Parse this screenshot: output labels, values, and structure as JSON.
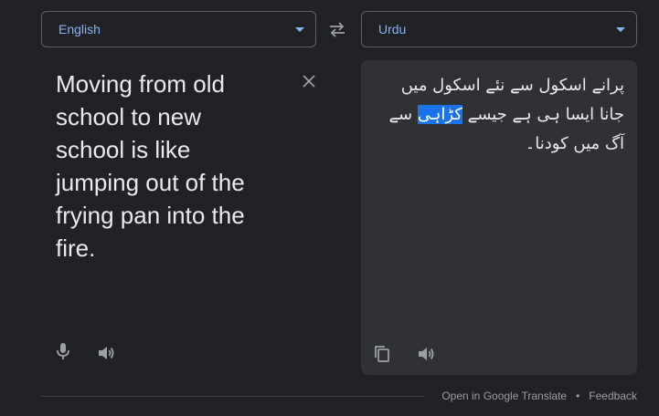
{
  "source_language": {
    "label": "English"
  },
  "target_language": {
    "label": "Urdu"
  },
  "source": {
    "text": "Moving from old school to new school is like jumping out of the frying pan into the fire."
  },
  "translation": {
    "text_before": "پرانے اسکول سے نئے اسکول میں جانا ایسا ہی ہے جیسے ",
    "text_highlight": "کڑاہی",
    "text_after": " سے آگ میں کودنا۔"
  },
  "footer": {
    "open_link": "Open in Google Translate",
    "separator": "•",
    "feedback": "Feedback"
  },
  "colors": {
    "background": "#202124",
    "panel": "#303134",
    "accent": "#8ab4f8",
    "highlight": "#1a73e8",
    "icon": "#9aa0a6"
  },
  "icons": {
    "dropdown": "caret-down-icon",
    "swap": "swap-arrows-icon",
    "clear": "close-icon",
    "mic": "microphone-icon",
    "speaker": "speaker-icon",
    "copy": "copy-icon"
  }
}
